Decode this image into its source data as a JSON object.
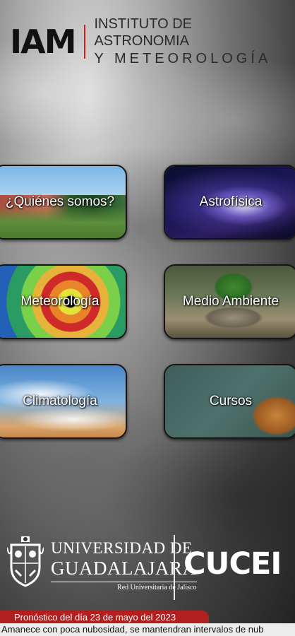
{
  "header": {
    "logo_mark": "IAM",
    "line1": "INSTITUTO DE ASTRONOMIA",
    "line2": "Y METEOROLOGÍA"
  },
  "tiles": [
    {
      "label": "¿Quiénes somos?"
    },
    {
      "label": "Astrofísica"
    },
    {
      "label": "Meteorología"
    },
    {
      "label": "Medio Ambiente"
    },
    {
      "label": "Climatología"
    },
    {
      "label": "Cursos"
    }
  ],
  "footer": {
    "udg_line1": "UNIVERSIDAD DE",
    "udg_line2": "GUADALAJARA",
    "udg_line3": "Red Universitaria de Jalisco",
    "cucei": "CUCEI"
  },
  "forecast": {
    "title": "Pronóstico del día 23 de mayo del 2023",
    "text": "Amanece con poca nubosidad, se mantendran intervalos de nub"
  },
  "colors": {
    "accent_red": "#b11f1f",
    "logo_bar_red": "#d31c1c"
  }
}
